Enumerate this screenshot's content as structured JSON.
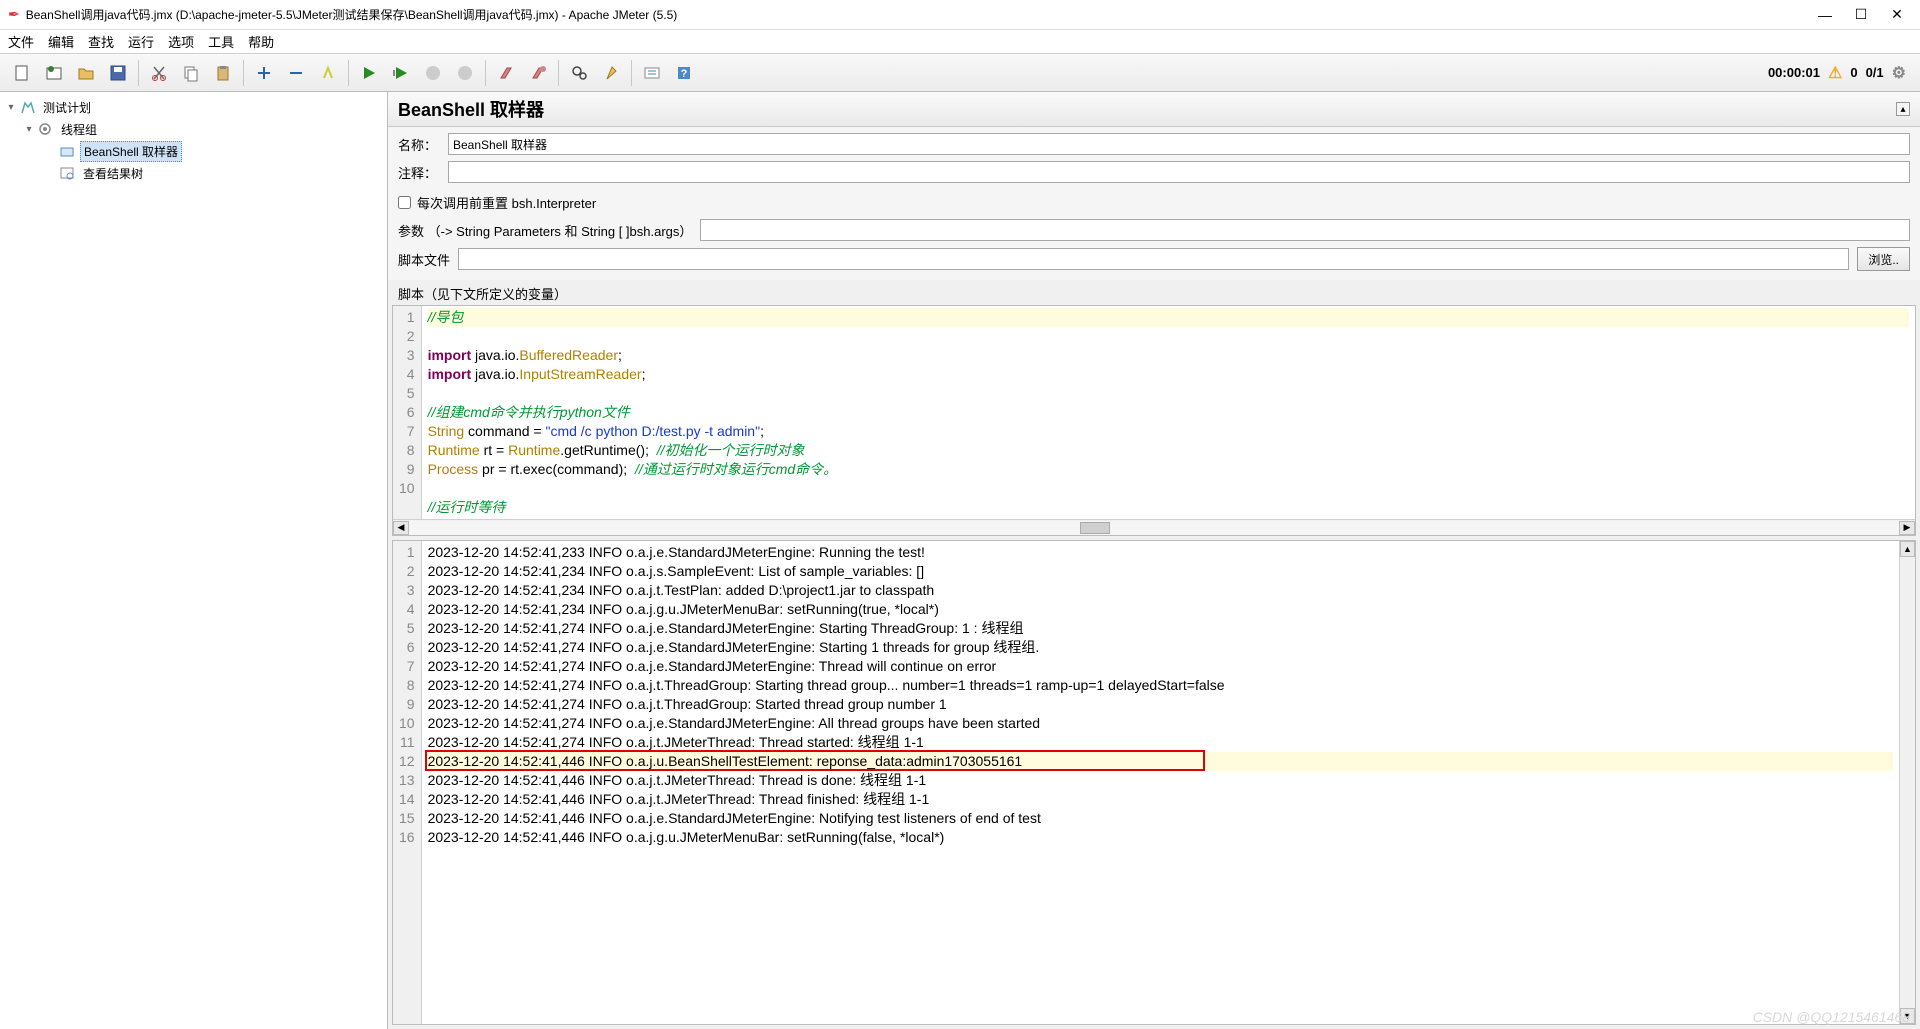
{
  "window": {
    "title": "BeanShell调用java代码.jmx (D:\\apache-jmeter-5.5\\JMeter测试结果保存\\BeanShell调用java代码.jmx) - Apache JMeter (5.5)"
  },
  "menu": {
    "file": "文件",
    "edit": "编辑",
    "search": "查找",
    "run": "运行",
    "options": "选项",
    "tools": "工具",
    "help": "帮助"
  },
  "status": {
    "time": "00:00:01",
    "warn_count": "0",
    "threads": "0/1"
  },
  "tree": {
    "root": "测试计划",
    "thread_group": "线程组",
    "sampler": "BeanShell 取样器",
    "results": "查看结果树"
  },
  "panel": {
    "title": "BeanShell 取样器",
    "name_label": "名称：",
    "name_value": "BeanShell 取样器",
    "comment_label": "注释：",
    "comment_value": "",
    "reset_chk": "每次调用前重置 bsh.Interpreter",
    "params_label": "参数 （-> String Parameters 和 String [ ]bsh.args）",
    "script_file_label": "脚本文件",
    "browse_btn": "浏览..",
    "script_label": "脚本（见下文所定义的变量）"
  },
  "code": {
    "lines": [
      {
        "n": "1",
        "html": "<span class='c-comment'>//导包</span>",
        "hl": true
      },
      {
        "n": "2",
        "html": "<span class='c-keyword'>import</span> java.io.<span class='c-type'>BufferedReader</span>;"
      },
      {
        "n": "3",
        "html": "<span class='c-keyword'>import</span> java.io.<span class='c-type'>InputStreamReader</span>;"
      },
      {
        "n": "4",
        "html": ""
      },
      {
        "n": "5",
        "html": "<span class='c-comment'>//组建cmd命令并执行python文件</span>"
      },
      {
        "n": "6",
        "html": "<span class='c-type'>String</span> command = <span class='c-string'>\"cmd /c python D:/test.py -t admin\"</span>;"
      },
      {
        "n": "7",
        "html": "<span class='c-type'>Runtime</span> rt = <span class='c-type'>Runtime</span>.getRuntime();  <span class='c-comment'>//初始化一个运行时对象</span>"
      },
      {
        "n": "8",
        "html": "<span class='c-type'>Process</span> pr = rt.exec(command);  <span class='c-comment'>//通过运行时对象运行cmd命令。</span>"
      },
      {
        "n": "9",
        "html": ""
      },
      {
        "n": "10",
        "html": "<span class='c-comment'>//运行时等待</span>"
      }
    ]
  },
  "log": {
    "lines": [
      {
        "n": "1",
        "t": "2023-12-20 14:52:41,233 INFO o.a.j.e.StandardJMeterEngine: Running the test!"
      },
      {
        "n": "2",
        "t": "2023-12-20 14:52:41,234 INFO o.a.j.s.SampleEvent: List of sample_variables: []"
      },
      {
        "n": "3",
        "t": "2023-12-20 14:52:41,234 INFO o.a.j.t.TestPlan: added D:\\project1.jar to classpath"
      },
      {
        "n": "4",
        "t": "2023-12-20 14:52:41,234 INFO o.a.j.g.u.JMeterMenuBar: setRunning(true, *local*)"
      },
      {
        "n": "5",
        "t": "2023-12-20 14:52:41,274 INFO o.a.j.e.StandardJMeterEngine: Starting ThreadGroup: 1 : 线程组"
      },
      {
        "n": "6",
        "t": "2023-12-20 14:52:41,274 INFO o.a.j.e.StandardJMeterEngine: Starting 1 threads for group 线程组."
      },
      {
        "n": "7",
        "t": "2023-12-20 14:52:41,274 INFO o.a.j.e.StandardJMeterEngine: Thread will continue on error"
      },
      {
        "n": "8",
        "t": "2023-12-20 14:52:41,274 INFO o.a.j.t.ThreadGroup: Starting thread group... number=1 threads=1 ramp-up=1 delayedStart=false"
      },
      {
        "n": "9",
        "t": "2023-12-20 14:52:41,274 INFO o.a.j.t.ThreadGroup: Started thread group number 1"
      },
      {
        "n": "10",
        "t": "2023-12-20 14:52:41,274 INFO o.a.j.e.StandardJMeterEngine: All thread groups have been started"
      },
      {
        "n": "11",
        "t": "2023-12-20 14:52:41,274 INFO o.a.j.t.JMeterThread: Thread started: 线程组 1-1"
      },
      {
        "n": "12",
        "t": "2023-12-20 14:52:41,446 INFO o.a.j.u.BeanShellTestElement: reponse_data:admin1703055161",
        "hl": true,
        "box": true
      },
      {
        "n": "13",
        "t": "2023-12-20 14:52:41,446 INFO o.a.j.t.JMeterThread: Thread is done: 线程组 1-1"
      },
      {
        "n": "14",
        "t": "2023-12-20 14:52:41,446 INFO o.a.j.t.JMeterThread: Thread finished: 线程组 1-1"
      },
      {
        "n": "15",
        "t": "2023-12-20 14:52:41,446 INFO o.a.j.e.StandardJMeterEngine: Notifying test listeners of end of test"
      },
      {
        "n": "16",
        "t": "2023-12-20 14:52:41,446 INFO o.a.j.g.u.JMeterMenuBar: setRunning(false, *local*)"
      }
    ]
  },
  "watermark": "CSDN @QQ1215461468"
}
